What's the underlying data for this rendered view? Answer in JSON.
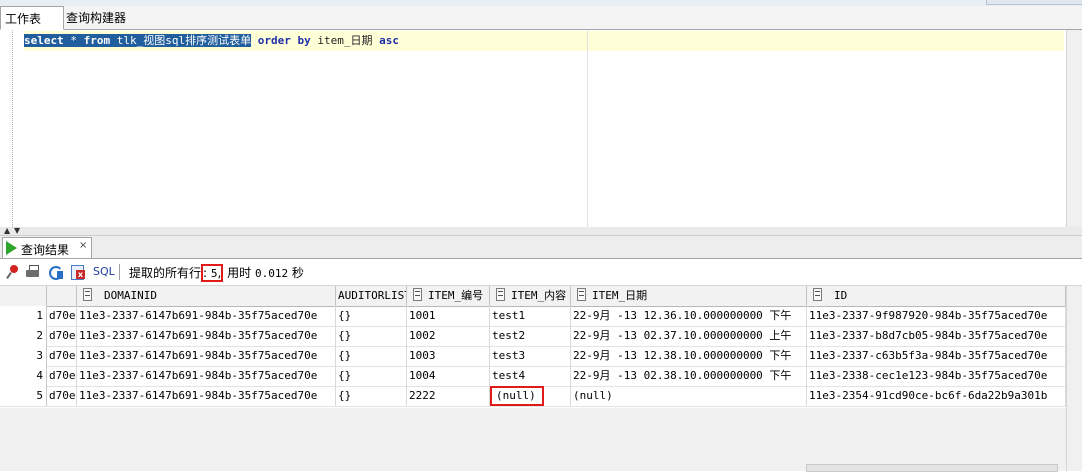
{
  "tabs": [
    {
      "label": "工作表"
    },
    {
      "label": "查询构建器"
    }
  ],
  "editor": {
    "sql_selected": {
      "kw1": "select",
      "star": " * ",
      "kw2": "from",
      "table": " tlk_视图sql排序测试表单"
    },
    "sql_rest": {
      "kw_order": "order",
      "kw_by": "by",
      "column": "item_日期",
      "kw_asc": "asc"
    }
  },
  "result_tab": {
    "label": "查询结果",
    "close": "×"
  },
  "toolbar": {
    "sql_label": "SQL",
    "status_prefix": "提取的所有行",
    "status_colon": ":",
    "row_count": "5",
    "status_comma": ",",
    "status_time_label": " 用时 ",
    "status_time": "0.012",
    "status_unit": " 秒"
  },
  "grid": {
    "columns": [
      "",
      "DOMAINID",
      "AUDITORLIST",
      "ITEM_编号",
      "ITEM_内容",
      "ITEM_日期",
      "ID"
    ],
    "rows": [
      {
        "num": "1",
        "c0": "d70e",
        "domainid": "11e3-2337-6147b691-984b-35f75aced70e",
        "auditorlist": "{}",
        "item_no": "1001",
        "item_content": "test1",
        "item_date": "22-9月 -13 12.36.10.000000000 下午",
        "id": "11e3-2337-9f987920-984b-35f75aced70e"
      },
      {
        "num": "2",
        "c0": "d70e",
        "domainid": "11e3-2337-6147b691-984b-35f75aced70e",
        "auditorlist": "{}",
        "item_no": "1002",
        "item_content": "test2",
        "item_date": "22-9月 -13 02.37.10.000000000 上午",
        "id": "11e3-2337-b8d7cb05-984b-35f75aced70e"
      },
      {
        "num": "3",
        "c0": "d70e",
        "domainid": "11e3-2337-6147b691-984b-35f75aced70e",
        "auditorlist": "{}",
        "item_no": "1003",
        "item_content": "test3",
        "item_date": "22-9月 -13 12.38.10.000000000 下午",
        "id": "11e3-2337-c63b5f3a-984b-35f75aced70e"
      },
      {
        "num": "4",
        "c0": "d70e",
        "domainid": "11e3-2337-6147b691-984b-35f75aced70e",
        "auditorlist": "{}",
        "item_no": "1004",
        "item_content": "test4",
        "item_date": "22-9月 -13 02.38.10.000000000 下午",
        "id": "11e3-2338-cec1e123-984b-35f75aced70e"
      },
      {
        "num": "5",
        "c0": "d70e",
        "domainid": "11e3-2337-6147b691-984b-35f75aced70e",
        "auditorlist": "{}",
        "item_no": "2222",
        "item_content": "(null)",
        "item_date": "(null)",
        "id": "11e3-2354-91cd90ce-bc6f-6da22b9a301b"
      }
    ]
  },
  "colors": {
    "highlight_box": "#e11b1b",
    "selection": "#215e9e",
    "keyword": "#1e2ea8",
    "current_line": "#ffffd7"
  },
  "icons": [
    "pin-icon",
    "print-icon",
    "refresh-icon",
    "export-icon",
    "play-icon",
    "sort-icon"
  ]
}
